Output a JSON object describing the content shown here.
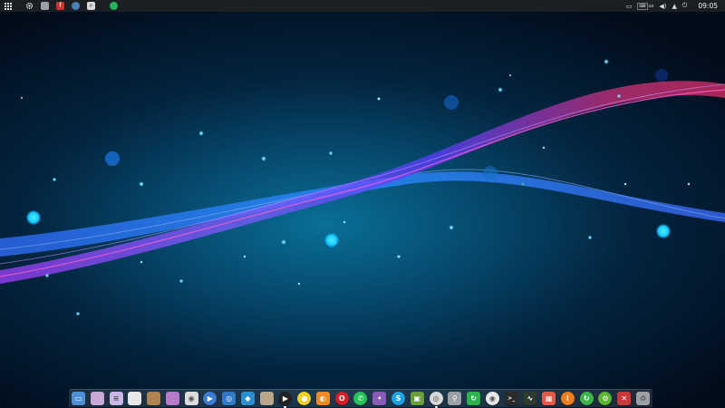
{
  "top_panel": {
    "launchers": [
      {
        "icon": "app-grid-icon",
        "color": "#1b1e23"
      },
      {
        "icon": "settings-gear-icon",
        "color": "#1b1e23"
      },
      {
        "icon": "files-icon",
        "color": "#9aa0a6"
      },
      {
        "icon": "flash-icon",
        "color": "#d0302a"
      },
      {
        "icon": "browser-icon",
        "color": "#4a7fb5"
      },
      {
        "icon": "search-tool-icon",
        "color": "#d9d9d9"
      },
      {
        "icon": "chat-app-icon",
        "color": "#23b35a"
      }
    ],
    "tray": {
      "keyboard_layout": "us",
      "clock": "09:05"
    }
  },
  "dock": {
    "icons": [
      {
        "name": "desktop-icon",
        "color": "#4f8fd8"
      },
      {
        "name": "files-icon",
        "color": "#c7a8d6"
      },
      {
        "name": "documents-icon",
        "color": "#c9b8e8"
      },
      {
        "name": "text-editor-icon",
        "color": "#e8e8e8"
      },
      {
        "name": "archive-icon",
        "color": "#b08450"
      },
      {
        "name": "disk-icon",
        "color": "#b57bc9"
      },
      {
        "name": "camera-icon",
        "color": "#dcdcdc"
      },
      {
        "name": "media-player-icon",
        "color": "#3a7bd5"
      },
      {
        "name": "screenshot-icon",
        "color": "#2f79c7"
      },
      {
        "name": "package-icon",
        "color": "#2a8fd0"
      },
      {
        "name": "scanner-icon",
        "color": "#b8a78a"
      },
      {
        "name": "video-player-icon",
        "color": "#222222"
      },
      {
        "name": "music-player-icon",
        "color": "#f0d020"
      },
      {
        "name": "firefox-icon",
        "color": "#f08a24"
      },
      {
        "name": "opera-icon",
        "color": "#d71e25"
      },
      {
        "name": "whatsapp-icon",
        "color": "#25c25a"
      },
      {
        "name": "pidgin-icon",
        "color": "#8a5bb8"
      },
      {
        "name": "skype-icon",
        "color": "#1aa1e6"
      },
      {
        "name": "cube-icon",
        "color": "#6a9e3a"
      },
      {
        "name": "disc-icon",
        "color": "#d8d8d8"
      },
      {
        "name": "usb-icon",
        "color": "#9aa0a6"
      },
      {
        "name": "sync-icon",
        "color": "#2bb24c"
      },
      {
        "name": "chrome-icon",
        "color": "#e8e8e8"
      },
      {
        "name": "terminal-icon",
        "color": "#2b2b2b"
      },
      {
        "name": "system-monitor-icon",
        "color": "#2d3a2d"
      },
      {
        "name": "software-center-icon",
        "color": "#e05a4a"
      },
      {
        "name": "info-icon",
        "color": "#f07d1a"
      },
      {
        "name": "update-icon",
        "color": "#3cb44b"
      },
      {
        "name": "settings-icon",
        "color": "#5ab52f"
      },
      {
        "name": "tools-icon",
        "color": "#c83a3a"
      },
      {
        "name": "trash-icon",
        "color": "#9aa0a6"
      }
    ]
  }
}
